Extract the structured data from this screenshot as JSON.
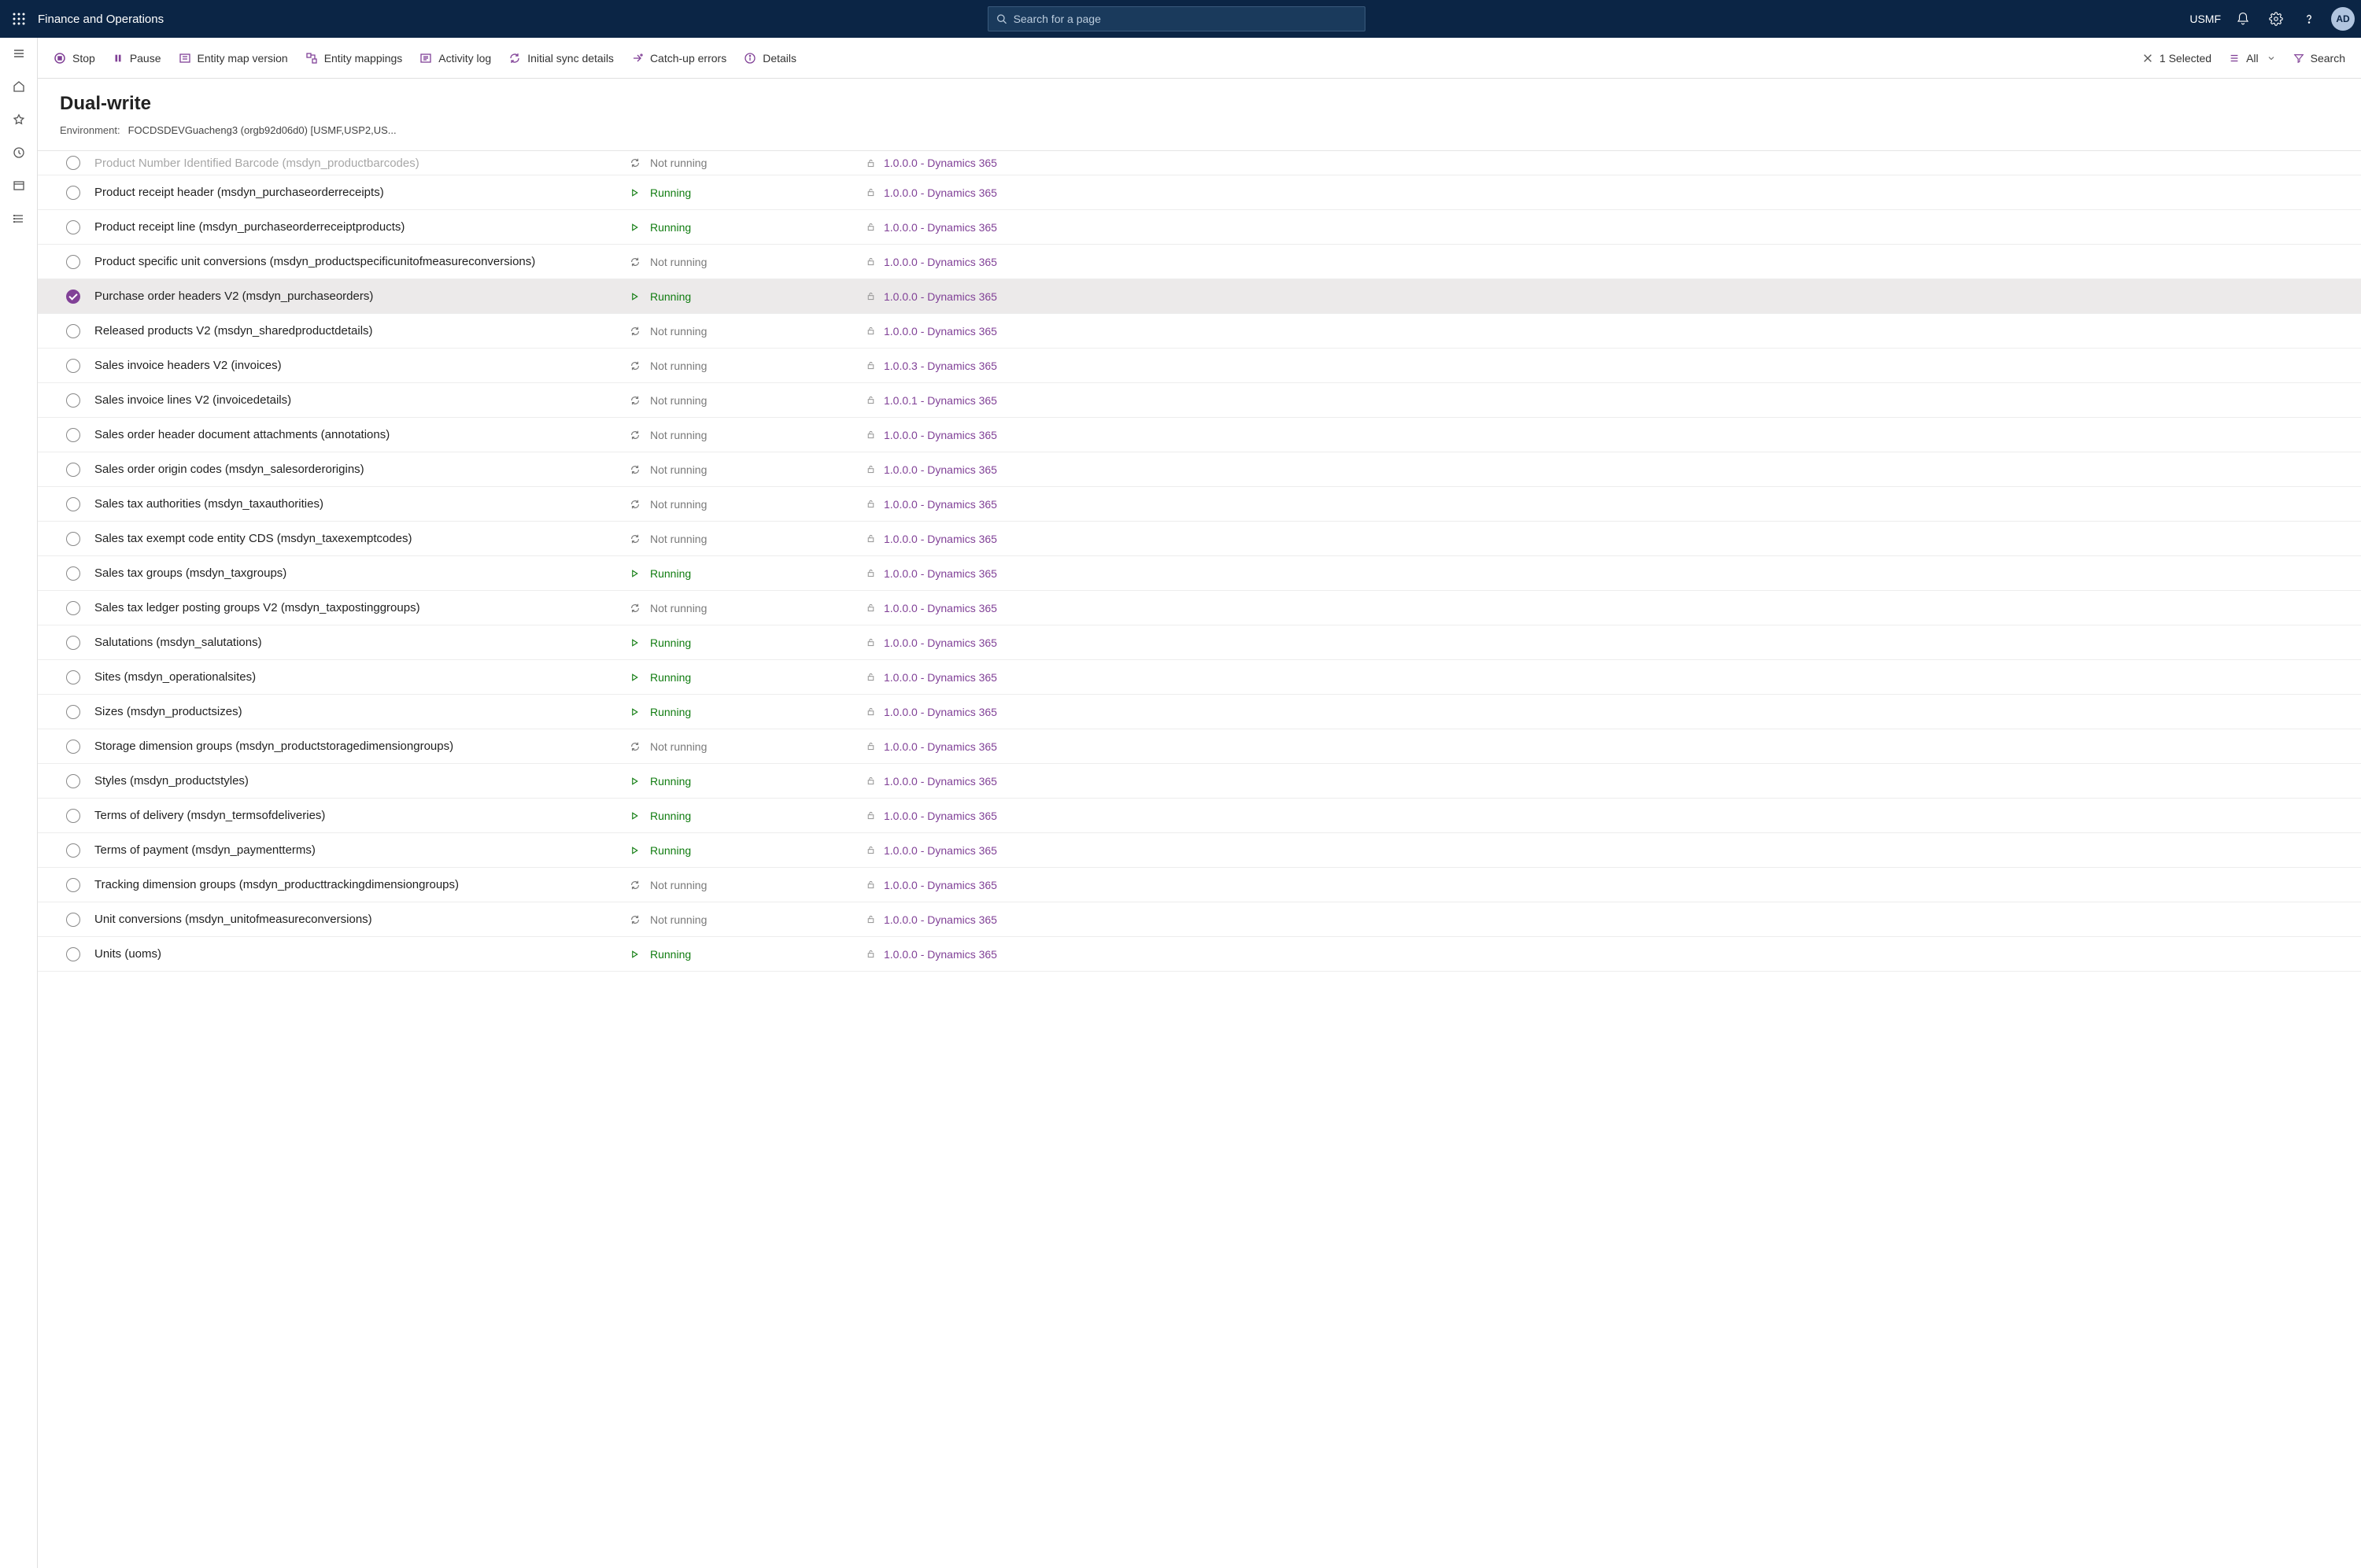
{
  "topbar": {
    "brand": "Finance and Operations",
    "search_placeholder": "Search for a page",
    "company": "USMF",
    "avatar_initials": "AD"
  },
  "actionbar": {
    "stop": "Stop",
    "pause": "Pause",
    "entity_map_version": "Entity map version",
    "entity_mappings": "Entity mappings",
    "activity_log": "Activity log",
    "initial_sync": "Initial sync details",
    "catchup_errors": "Catch-up errors",
    "details": "Details",
    "selected_count": "1 Selected",
    "filter_all": "All",
    "search": "Search"
  },
  "heading": {
    "title": "Dual-write"
  },
  "environment": {
    "label": "Environment:",
    "value": "FOCDSDEVGuacheng3 (orgb92d06d0) [USMF,USP2,US..."
  },
  "status_labels": {
    "running": "Running",
    "not_running": "Not running"
  },
  "rows": [
    {
      "name": "Product Number Identified Barcode (msdyn_productbarcodes)",
      "status": "not_running",
      "version": "1.0.0.0 - Dynamics 365",
      "selected": false,
      "cutoff": true
    },
    {
      "name": "Product receipt header (msdyn_purchaseorderreceipts)",
      "status": "running",
      "version": "1.0.0.0 - Dynamics 365",
      "selected": false
    },
    {
      "name": "Product receipt line (msdyn_purchaseorderreceiptproducts)",
      "status": "running",
      "version": "1.0.0.0 - Dynamics 365",
      "selected": false
    },
    {
      "name": "Product specific unit conversions (msdyn_productspecificunitofmeasureconversions)",
      "status": "not_running",
      "version": "1.0.0.0 - Dynamics 365",
      "selected": false
    },
    {
      "name": "Purchase order headers V2 (msdyn_purchaseorders)",
      "status": "running",
      "version": "1.0.0.0 - Dynamics 365",
      "selected": true
    },
    {
      "name": "Released products V2 (msdyn_sharedproductdetails)",
      "status": "not_running",
      "version": "1.0.0.0 - Dynamics 365",
      "selected": false
    },
    {
      "name": "Sales invoice headers V2 (invoices)",
      "status": "not_running",
      "version": "1.0.0.3 - Dynamics 365",
      "selected": false
    },
    {
      "name": "Sales invoice lines V2 (invoicedetails)",
      "status": "not_running",
      "version": "1.0.0.1 - Dynamics 365",
      "selected": false
    },
    {
      "name": "Sales order header document attachments (annotations)",
      "status": "not_running",
      "version": "1.0.0.0 - Dynamics 365",
      "selected": false
    },
    {
      "name": "Sales order origin codes (msdyn_salesorderorigins)",
      "status": "not_running",
      "version": "1.0.0.0 - Dynamics 365",
      "selected": false
    },
    {
      "name": "Sales tax authorities (msdyn_taxauthorities)",
      "status": "not_running",
      "version": "1.0.0.0 - Dynamics 365",
      "selected": false
    },
    {
      "name": "Sales tax exempt code entity CDS (msdyn_taxexemptcodes)",
      "status": "not_running",
      "version": "1.0.0.0 - Dynamics 365",
      "selected": false
    },
    {
      "name": "Sales tax groups (msdyn_taxgroups)",
      "status": "running",
      "version": "1.0.0.0 - Dynamics 365",
      "selected": false
    },
    {
      "name": "Sales tax ledger posting groups V2 (msdyn_taxpostinggroups)",
      "status": "not_running",
      "version": "1.0.0.0 - Dynamics 365",
      "selected": false
    },
    {
      "name": "Salutations (msdyn_salutations)",
      "status": "running",
      "version": "1.0.0.0 - Dynamics 365",
      "selected": false
    },
    {
      "name": "Sites (msdyn_operationalsites)",
      "status": "running",
      "version": "1.0.0.0 - Dynamics 365",
      "selected": false
    },
    {
      "name": "Sizes (msdyn_productsizes)",
      "status": "running",
      "version": "1.0.0.0 - Dynamics 365",
      "selected": false
    },
    {
      "name": "Storage dimension groups (msdyn_productstoragedimensiongroups)",
      "status": "not_running",
      "version": "1.0.0.0 - Dynamics 365",
      "selected": false
    },
    {
      "name": "Styles (msdyn_productstyles)",
      "status": "running",
      "version": "1.0.0.0 - Dynamics 365",
      "selected": false
    },
    {
      "name": "Terms of delivery (msdyn_termsofdeliveries)",
      "status": "running",
      "version": "1.0.0.0 - Dynamics 365",
      "selected": false
    },
    {
      "name": "Terms of payment (msdyn_paymentterms)",
      "status": "running",
      "version": "1.0.0.0 - Dynamics 365",
      "selected": false
    },
    {
      "name": "Tracking dimension groups (msdyn_producttrackingdimensiongroups)",
      "status": "not_running",
      "version": "1.0.0.0 - Dynamics 365",
      "selected": false
    },
    {
      "name": "Unit conversions (msdyn_unitofmeasureconversions)",
      "status": "not_running",
      "version": "1.0.0.0 - Dynamics 365",
      "selected": false
    },
    {
      "name": "Units (uoms)",
      "status": "running",
      "version": "1.0.0.0 - Dynamics 365",
      "selected": false
    }
  ]
}
